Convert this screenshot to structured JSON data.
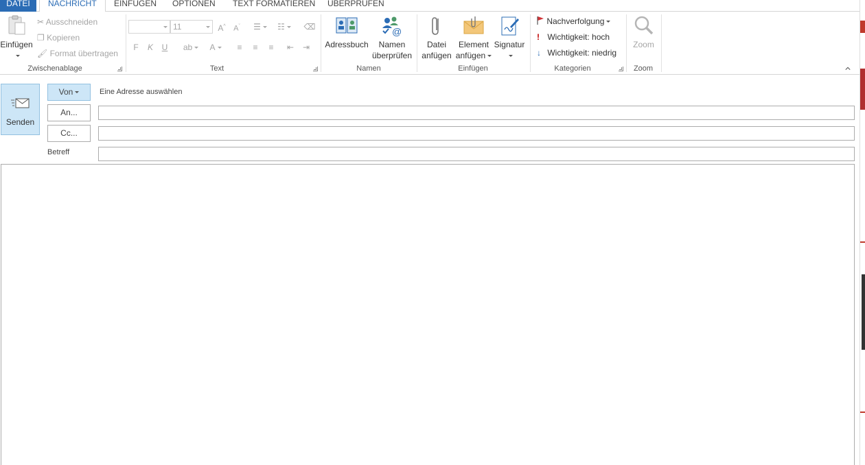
{
  "tabs": [
    {
      "label": "DATEI"
    },
    {
      "label": "NACHRICHT"
    },
    {
      "label": "EINFÜGEN"
    },
    {
      "label": "OPTIONEN"
    },
    {
      "label": "TEXT FORMATIEREN"
    },
    {
      "label": "ÜBERPRÜFEN"
    }
  ],
  "clipboard": {
    "paste_label": "Einfügen",
    "cut_label": "Ausschneiden",
    "copy_label": "Kopieren",
    "format_painter_label": "Format übertragen",
    "group_label": "Zwischenablage"
  },
  "text_group": {
    "font_name": "",
    "font_size": "11",
    "bold": "F",
    "italic": "K",
    "underline": "U",
    "group_label": "Text"
  },
  "names_group": {
    "address_book_label": "Adressbuch",
    "check_names_line1": "Namen",
    "check_names_line2": "überprüfen",
    "group_label": "Namen"
  },
  "include_group": {
    "attach_file_line1": "Datei",
    "attach_file_line2": "anfügen",
    "attach_item_line1": "Element",
    "attach_item_line2": "anfügen",
    "signature_label": "Signatur",
    "group_label": "Einfügen"
  },
  "tags_group": {
    "follow_up_label": "Nachverfolgung",
    "high_importance_label": "Wichtigkeit: hoch",
    "low_importance_label": "Wichtigkeit: niedrig",
    "group_label": "Kategorien"
  },
  "zoom_group": {
    "zoom_label": "Zoom",
    "group_label": "Zoom"
  },
  "compose": {
    "send_label": "Senden",
    "from_button_label": "Von",
    "from_value": "Eine Adresse auswählen",
    "to_button_label": "An...",
    "cc_button_label": "Cc...",
    "subject_label": "Betreff",
    "to_value": "",
    "cc_value": "",
    "subject_value": "",
    "body_value": ""
  },
  "colors": {
    "accent": "#2b6cb5",
    "selected_fill": "#cde6f7",
    "selected_border": "#92c0e0",
    "flag_red": "#d13438",
    "importance_high": "#c00000",
    "importance_low": "#2b6cb5"
  }
}
